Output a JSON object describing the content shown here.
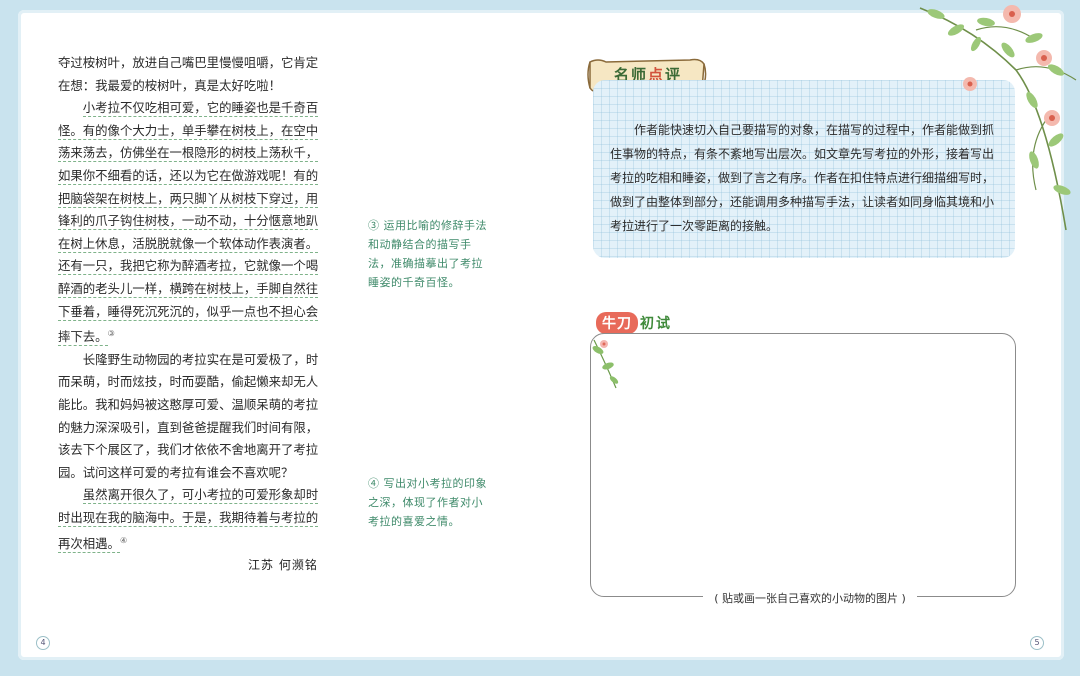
{
  "left_page": {
    "paragraphs": [
      "夺过桉树叶，放进自己嘴巴里慢慢咀嚼，它肯定在想：我最爱的桉树叶，真是太好吃啦！",
      "小考拉不仅吃相可爱，它的睡姿也是千奇百怪。有的像个大力士，单手攀在树枝上，在空中荡来荡去，仿佛坐在一根隐形的树枝上荡秋千，如果你不细看的话，还以为它在做游戏呢！有的把脑袋架在树枝上，两只脚丫从树枝下穿过，用锋利的爪子钩住树枝，一动不动，十分惬意地趴在树上休息，活脱脱就像一个软体动作表演者。还有一只，我把它称为醉酒考拉，它就像一个喝醉酒的老头儿一样，横跨在树枝上，手脚自然往下垂着，睡得死沉死沉的，似乎一点也不担心会摔下去。",
      "长隆野生动物园的考拉实在是可爱极了，时而呆萌，时而炫技，时而耍酷，偷起懒来却无人能比。我和妈妈被这憨厚可爱、温顺呆萌的考拉的魅力深深吸引，直到爸爸提醒我们时间有限，该去下个展区了，我们才依依不舍地离开了考拉园。试问这样可爱的考拉有谁会不喜欢呢？",
      "虽然离开很久了，可小考拉的可爱形象却时时出现在我的脑海中。于是，我期待着与考拉的再次相遇。"
    ],
    "marker_3": "③",
    "marker_4": "④",
    "author": "江苏 何濒铭",
    "notes": [
      "③ 运用比喻的修辞手法和动静结合的描写手法，准确描摹出了考拉睡姿的千奇百怪。",
      "④ 写出对小考拉的印象之深，体现了作者对小考拉的喜爱之情。"
    ],
    "page_number": "4"
  },
  "right_page": {
    "banner": {
      "part1": "名师",
      "part2": "点",
      "part3": "评"
    },
    "comment": "作者能快速切入自己要描写的对象，在描写的过程中，作者能做到抓住事物的特点，有条不紊地写出层次。如文章先写考拉的外形，接着写出考拉的吃相和睡姿，做到了言之有序。作者在扣住特点进行细描细写时，做到了由整体到部分，还能调用多种描写手法，让读者如同身临其境和小考拉进行了一次零距离的接触。",
    "trial_title": {
      "pill": "牛刀",
      "rest": "初试"
    },
    "caption": "( 贴或画一张自己喜欢的小动物的图片 )",
    "page_number": "5"
  },
  "colors": {
    "background": "#c9e3ee",
    "note_text": "#3f8a6a",
    "underline": "#7fb38a",
    "banner_green": "#3b6a35",
    "accent_red": "#e86a5a"
  },
  "icons": [
    "leafy-branch-decoration",
    "flower-sprig-decoration",
    "scroll-banner"
  ]
}
